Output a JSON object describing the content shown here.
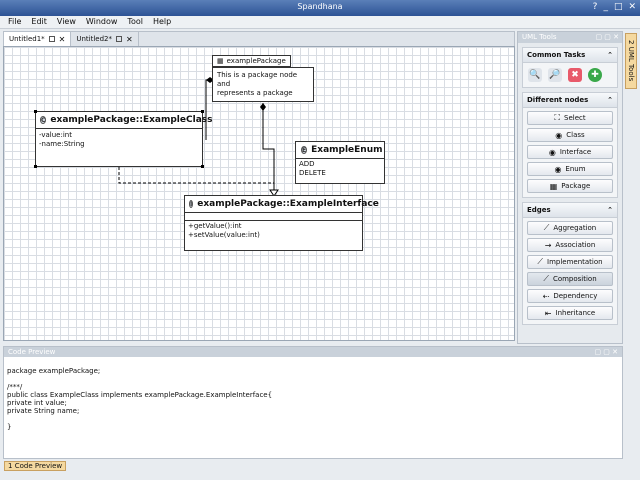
{
  "window": {
    "title": "Spandhana",
    "controls": [
      "?",
      "_",
      "□",
      "✕"
    ]
  },
  "menu": [
    "File",
    "Edit",
    "View",
    "Window",
    "Tool",
    "Help"
  ],
  "editor_tabs": [
    {
      "label": "Untitled1*",
      "active": true
    },
    {
      "label": "Untitled2*",
      "active": false
    }
  ],
  "diagram": {
    "package": {
      "name": "examplePackage",
      "note": [
        "This is a package node and",
        "represents a package"
      ]
    },
    "example_class": {
      "title": "examplePackage::ExampleClass",
      "attributes": [
        "-value:int",
        "-name:String"
      ],
      "icon": "C"
    },
    "example_enum": {
      "title": "ExampleEnum",
      "values": [
        "ADD",
        "DELETE"
      ],
      "icon": "E"
    },
    "example_interface": {
      "title": "examplePackage::ExampleInterface",
      "methods": [
        "+getValue():int",
        "+setValue(value:int)"
      ],
      "icon": "I"
    }
  },
  "uml_tools": {
    "title": "UML Tools",
    "common_tasks": {
      "title": "Common Tasks",
      "icons": [
        "zoom-in-icon",
        "zoom-out-icon",
        "delete-icon",
        "add-icon"
      ]
    },
    "different_nodes": {
      "title": "Different nodes",
      "items": [
        {
          "label": "Select",
          "icon": "select-icon",
          "glyph": "⛶"
        },
        {
          "label": "Class",
          "icon": "class-icon",
          "glyph": "◉"
        },
        {
          "label": "Interface",
          "icon": "interface-icon",
          "glyph": "◉"
        },
        {
          "label": "Enum",
          "icon": "enum-icon",
          "glyph": "◉"
        },
        {
          "label": "Package",
          "icon": "package-icon",
          "glyph": "▦"
        }
      ]
    },
    "edges": {
      "title": "Edges",
      "items": [
        {
          "label": "Aggregation",
          "icon": "aggregation-icon",
          "glyph": "⟋"
        },
        {
          "label": "Association",
          "icon": "association-icon",
          "glyph": "→"
        },
        {
          "label": "Implementation",
          "icon": "implementation-icon",
          "glyph": "⟋"
        },
        {
          "label": "Composition",
          "icon": "composition-icon",
          "glyph": "⟋",
          "selected": true
        },
        {
          "label": "Dependency",
          "icon": "dependency-icon",
          "glyph": "⇠"
        },
        {
          "label": "Inheritance",
          "icon": "inheritance-icon",
          "glyph": "⇤"
        }
      ]
    }
  },
  "side_tab": {
    "label": "UML Tools",
    "index": "2"
  },
  "code_preview": {
    "title": "Code Preview",
    "code": "package examplePackage;\n\n/***/\npublic class ExampleClass implements examplePackage.ExampleInterface{\nprivate int value;\nprivate String name;\n\n}"
  },
  "status_tab": {
    "index": "1",
    "label": "Code Preview"
  }
}
